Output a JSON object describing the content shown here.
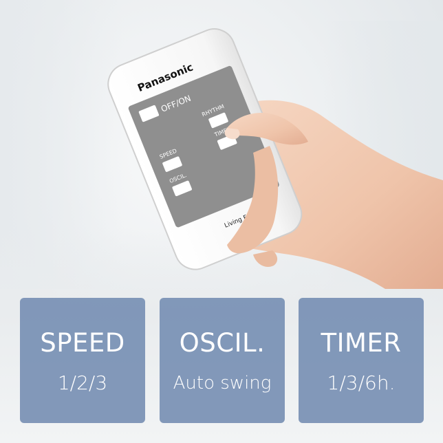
{
  "remote": {
    "brand": "Panasonic",
    "buttons": {
      "power_label": "OFF/ON",
      "rhythm_label": "RHYTHM",
      "speed_label": "SPEED",
      "timer_label": "TIMER",
      "oscil_label": "OSCIL."
    },
    "model_label": "Living Fan"
  },
  "features": [
    {
      "title": "SPEED",
      "value": "1/2/3"
    },
    {
      "title": "OSCIL.",
      "value": "Auto swing"
    },
    {
      "title": "TIMER",
      "value": "1/3/6h."
    }
  ],
  "colors": {
    "card_fill": "#758eb2",
    "remote_panel": "#8f8f8f",
    "remote_body": "#ffffff",
    "skin": "#f2cdb6"
  }
}
